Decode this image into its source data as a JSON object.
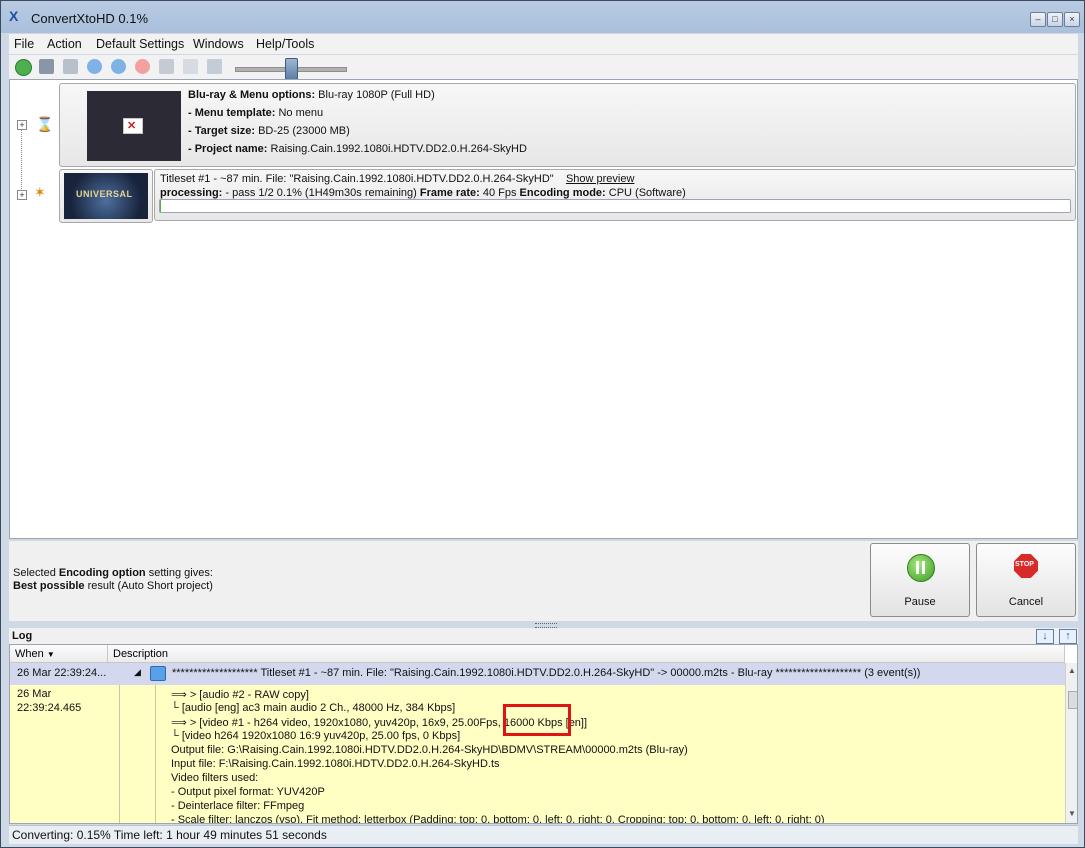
{
  "window": {
    "title": "ConvertXtoHD 0.1%",
    "logo": "X"
  },
  "menu": [
    "File",
    "Action",
    "Default Settings",
    "Windows",
    "Help/Tools"
  ],
  "toolbar": {
    "icons": [
      "add-icon",
      "save-icon",
      "settings-icon",
      "move-down-icon",
      "move-up-icon",
      "remove-icon",
      "tools-icon",
      "grid-icon",
      "monitor-icon"
    ],
    "slider_label": "zoom-slider"
  },
  "project": {
    "menu_options_label": "Blu-ray & Menu options:",
    "menu_options_value": "Blu-ray 1080P (Full HD)",
    "menu_template_label": "- Menu template:",
    "menu_template_value": "No menu",
    "target_size_label": "- Target size:",
    "target_size_value": "BD-25 (23000 MB)",
    "project_name_label": "- Project name:",
    "project_name_value": "Raising.Cain.1992.1080i.HDTV.DD2.0.H.264-SkyHD"
  },
  "titleset": {
    "title_line": "Titleset #1 - ~87 min. File: \"Raising.Cain.1992.1080i.HDTV.DD2.0.H.264-SkyHD\"",
    "show_preview": "Show preview",
    "processing_label": "processing:",
    "processing_value": "- pass 1/2  0.1% (1H49m30s remaining)",
    "frame_rate_label": "Frame rate:",
    "frame_rate_value": "40 Fps",
    "encoding_mode_label": "Encoding mode:",
    "encoding_mode_value": "CPU (Software)",
    "thumb_text": "UNIVERSAL",
    "progress": 0.1
  },
  "summary": {
    "line1_pre": "Selected ",
    "line1_bold": "Encoding option",
    "line1_post": " setting gives:",
    "line2_bold": "Best possible",
    "line2_post": " result (Auto Short project)"
  },
  "buttons": {
    "pause": "Pause",
    "cancel": "Cancel",
    "stop_sign": "STOP"
  },
  "log": {
    "title": "Log",
    "col_when": "When",
    "col_description": "Description",
    "row1_when": "26 Mar 22:39:24...",
    "row1_desc": "******************** Titleset #1 - ~87 min. File: \"Raising.Cain.1992.1080i.HDTV.DD2.0.H.264-SkyHD\" -> 00000.m2ts - Blu-ray ******************** (3 event(s))",
    "row2_when_a": "26 Mar",
    "row2_when_b": "22:39:24.465",
    "lines": [
      "> [audio #2 - RAW copy]",
      "[audio [eng] ac3 main audio 2 Ch., 48000 Hz, 384 Kbps]",
      "> [video #1 - h264 video, 1920x1080, yuv420p, 16x9, 25.00Fps, 16000 Kbps [en]]",
      "[video h264 1920x1080 16:9 yuv420p, 25.00 fps, 0 Kbps]",
      "Output file: G:\\Raising.Cain.1992.1080i.HDTV.DD2.0.H.264-SkyHD\\BDMV\\STREAM\\00000.m2ts (Blu-ray)",
      "Input file: F:\\Raising.Cain.1992.1080i.HDTV.DD2.0.H.264-SkyHD.ts",
      "Video filters used:",
      "- Output pixel format: YUV420P",
      "- Deinterlace filter: FFmpeg",
      "- Scale filter: lanczos (vso), Fit method: letterbox (Padding: top: 0, bottom: 0, left: 0, right: 0, Cropping: top: 0, bottom: 0, left: 0, right: 0)"
    ]
  },
  "status": "Converting: 0.15% Time left: 1 hour 49 minutes 51 seconds"
}
